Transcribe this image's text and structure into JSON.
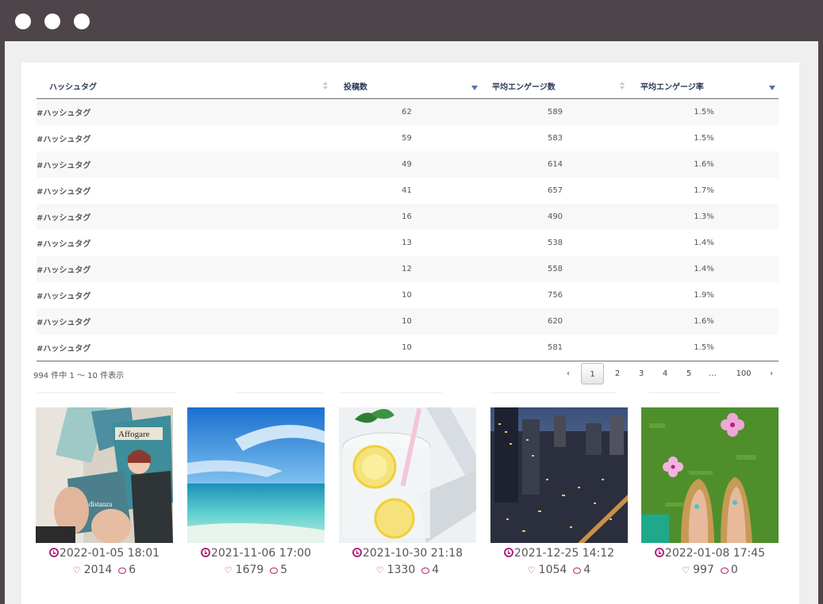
{
  "table": {
    "headers": [
      "ハッシュタグ",
      "投稿数",
      "平均エンゲージ数",
      "平均エンゲージ率"
    ],
    "rows": [
      {
        "tag": "#ハッシュタグ",
        "posts": "62",
        "avg_engage": "589",
        "avg_rate": "1.5%"
      },
      {
        "tag": "#ハッシュタグ",
        "posts": "59",
        "avg_engage": "583",
        "avg_rate": "1.5%"
      },
      {
        "tag": "#ハッシュタグ",
        "posts": "49",
        "avg_engage": "614",
        "avg_rate": "1.6%"
      },
      {
        "tag": "#ハッシュタグ",
        "posts": "41",
        "avg_engage": "657",
        "avg_rate": "1.7%"
      },
      {
        "tag": "#ハッシュタグ",
        "posts": "16",
        "avg_engage": "490",
        "avg_rate": "1.3%"
      },
      {
        "tag": "#ハッシュタグ",
        "posts": "13",
        "avg_engage": "538",
        "avg_rate": "1.4%"
      },
      {
        "tag": "#ハッシュタグ",
        "posts": "12",
        "avg_engage": "558",
        "avg_rate": "1.4%"
      },
      {
        "tag": "#ハッシュタグ",
        "posts": "10",
        "avg_engage": "756",
        "avg_rate": "1.9%"
      },
      {
        "tag": "#ハッシュタグ",
        "posts": "10",
        "avg_engage": "620",
        "avg_rate": "1.6%"
      },
      {
        "tag": "#ハッシュタグ",
        "posts": "10",
        "avg_engage": "581",
        "avg_rate": "1.5%"
      }
    ],
    "summary": "994 件中 1 〜 10 件表示"
  },
  "pagination": {
    "prev": "‹",
    "pages": [
      "1",
      "2",
      "3",
      "4",
      "5",
      "…",
      "100"
    ],
    "current": "1",
    "next": "›"
  },
  "posts": [
    {
      "date": "2022-01-05 18:01",
      "likes": "2014",
      "comments": "6",
      "image": "magazines-photo"
    },
    {
      "date": "2021-11-06 17:00",
      "likes": "1679",
      "comments": "5",
      "image": "beach-photo"
    },
    {
      "date": "2021-10-30 21:18",
      "likes": "1330",
      "comments": "4",
      "image": "lemon-drink-photo"
    },
    {
      "date": "2021-12-25 14:12",
      "likes": "1054",
      "comments": "4",
      "image": "city-night-photo"
    },
    {
      "date": "2022-01-08 17:45",
      "likes": "997",
      "comments": "0",
      "image": "sandals-grass-photo"
    }
  ],
  "colors": {
    "frame": "#4d4549",
    "accent": "#b0237a",
    "header_text": "#2b3a55",
    "sort_active": "#5a6db3"
  },
  "icons": {
    "window_controls": [
      "window-dot-icon",
      "window-dot-icon",
      "window-dot-icon"
    ],
    "sort": "sort-icon",
    "sort_active": "sort-desc-icon",
    "date": "clock-icon",
    "likes": "heart-icon",
    "comments": "comment-icon"
  }
}
